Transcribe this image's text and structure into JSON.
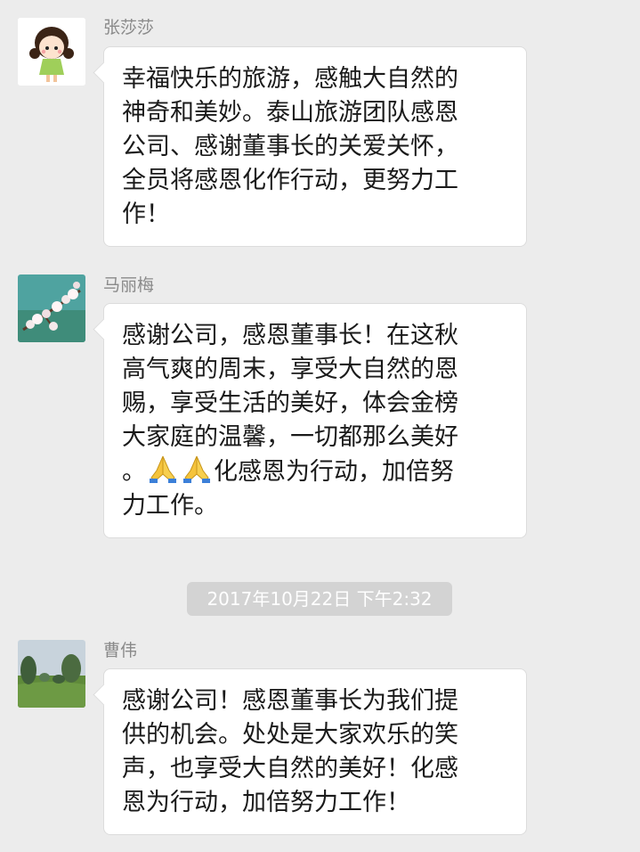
{
  "messages": [
    {
      "sender": "张莎莎",
      "avatar_icon": "cartoon-girl-avatar-icon",
      "lines": [
        "幸福快乐的旅游，感触大自然的",
        "神奇和美妙。泰山旅游团队感恩",
        "公司、感谢董事长的关爱关怀，",
        "全员将感恩化作行动，更努力工",
        "作！"
      ]
    },
    {
      "sender": "马丽梅",
      "avatar_icon": "cherry-blossom-avatar-icon",
      "lines": [
        "感谢公司，感恩董事长！在这秋",
        "高气爽的周末，享受大自然的恩",
        "赐，享受生活的美好，体会金榜",
        "大家庭的温馨，一切都那么美好"
      ],
      "line5_prefix": "。",
      "line5_suffix": "化感恩为行动，加倍努",
      "emoji_icon": "folded-hands-icon",
      "line6": "力工作。"
    },
    {
      "sender": "曹伟",
      "avatar_icon": "garden-photo-avatar-icon",
      "lines": [
        "感谢公司！感恩董事长为我们提",
        "供的机会。处处是大家欢乐的笑",
        "声，也享受大自然的美好！化感",
        "恩为行动，加倍努力工作！"
      ]
    }
  ],
  "timestamp": "2017年10月22日 下午2:32"
}
